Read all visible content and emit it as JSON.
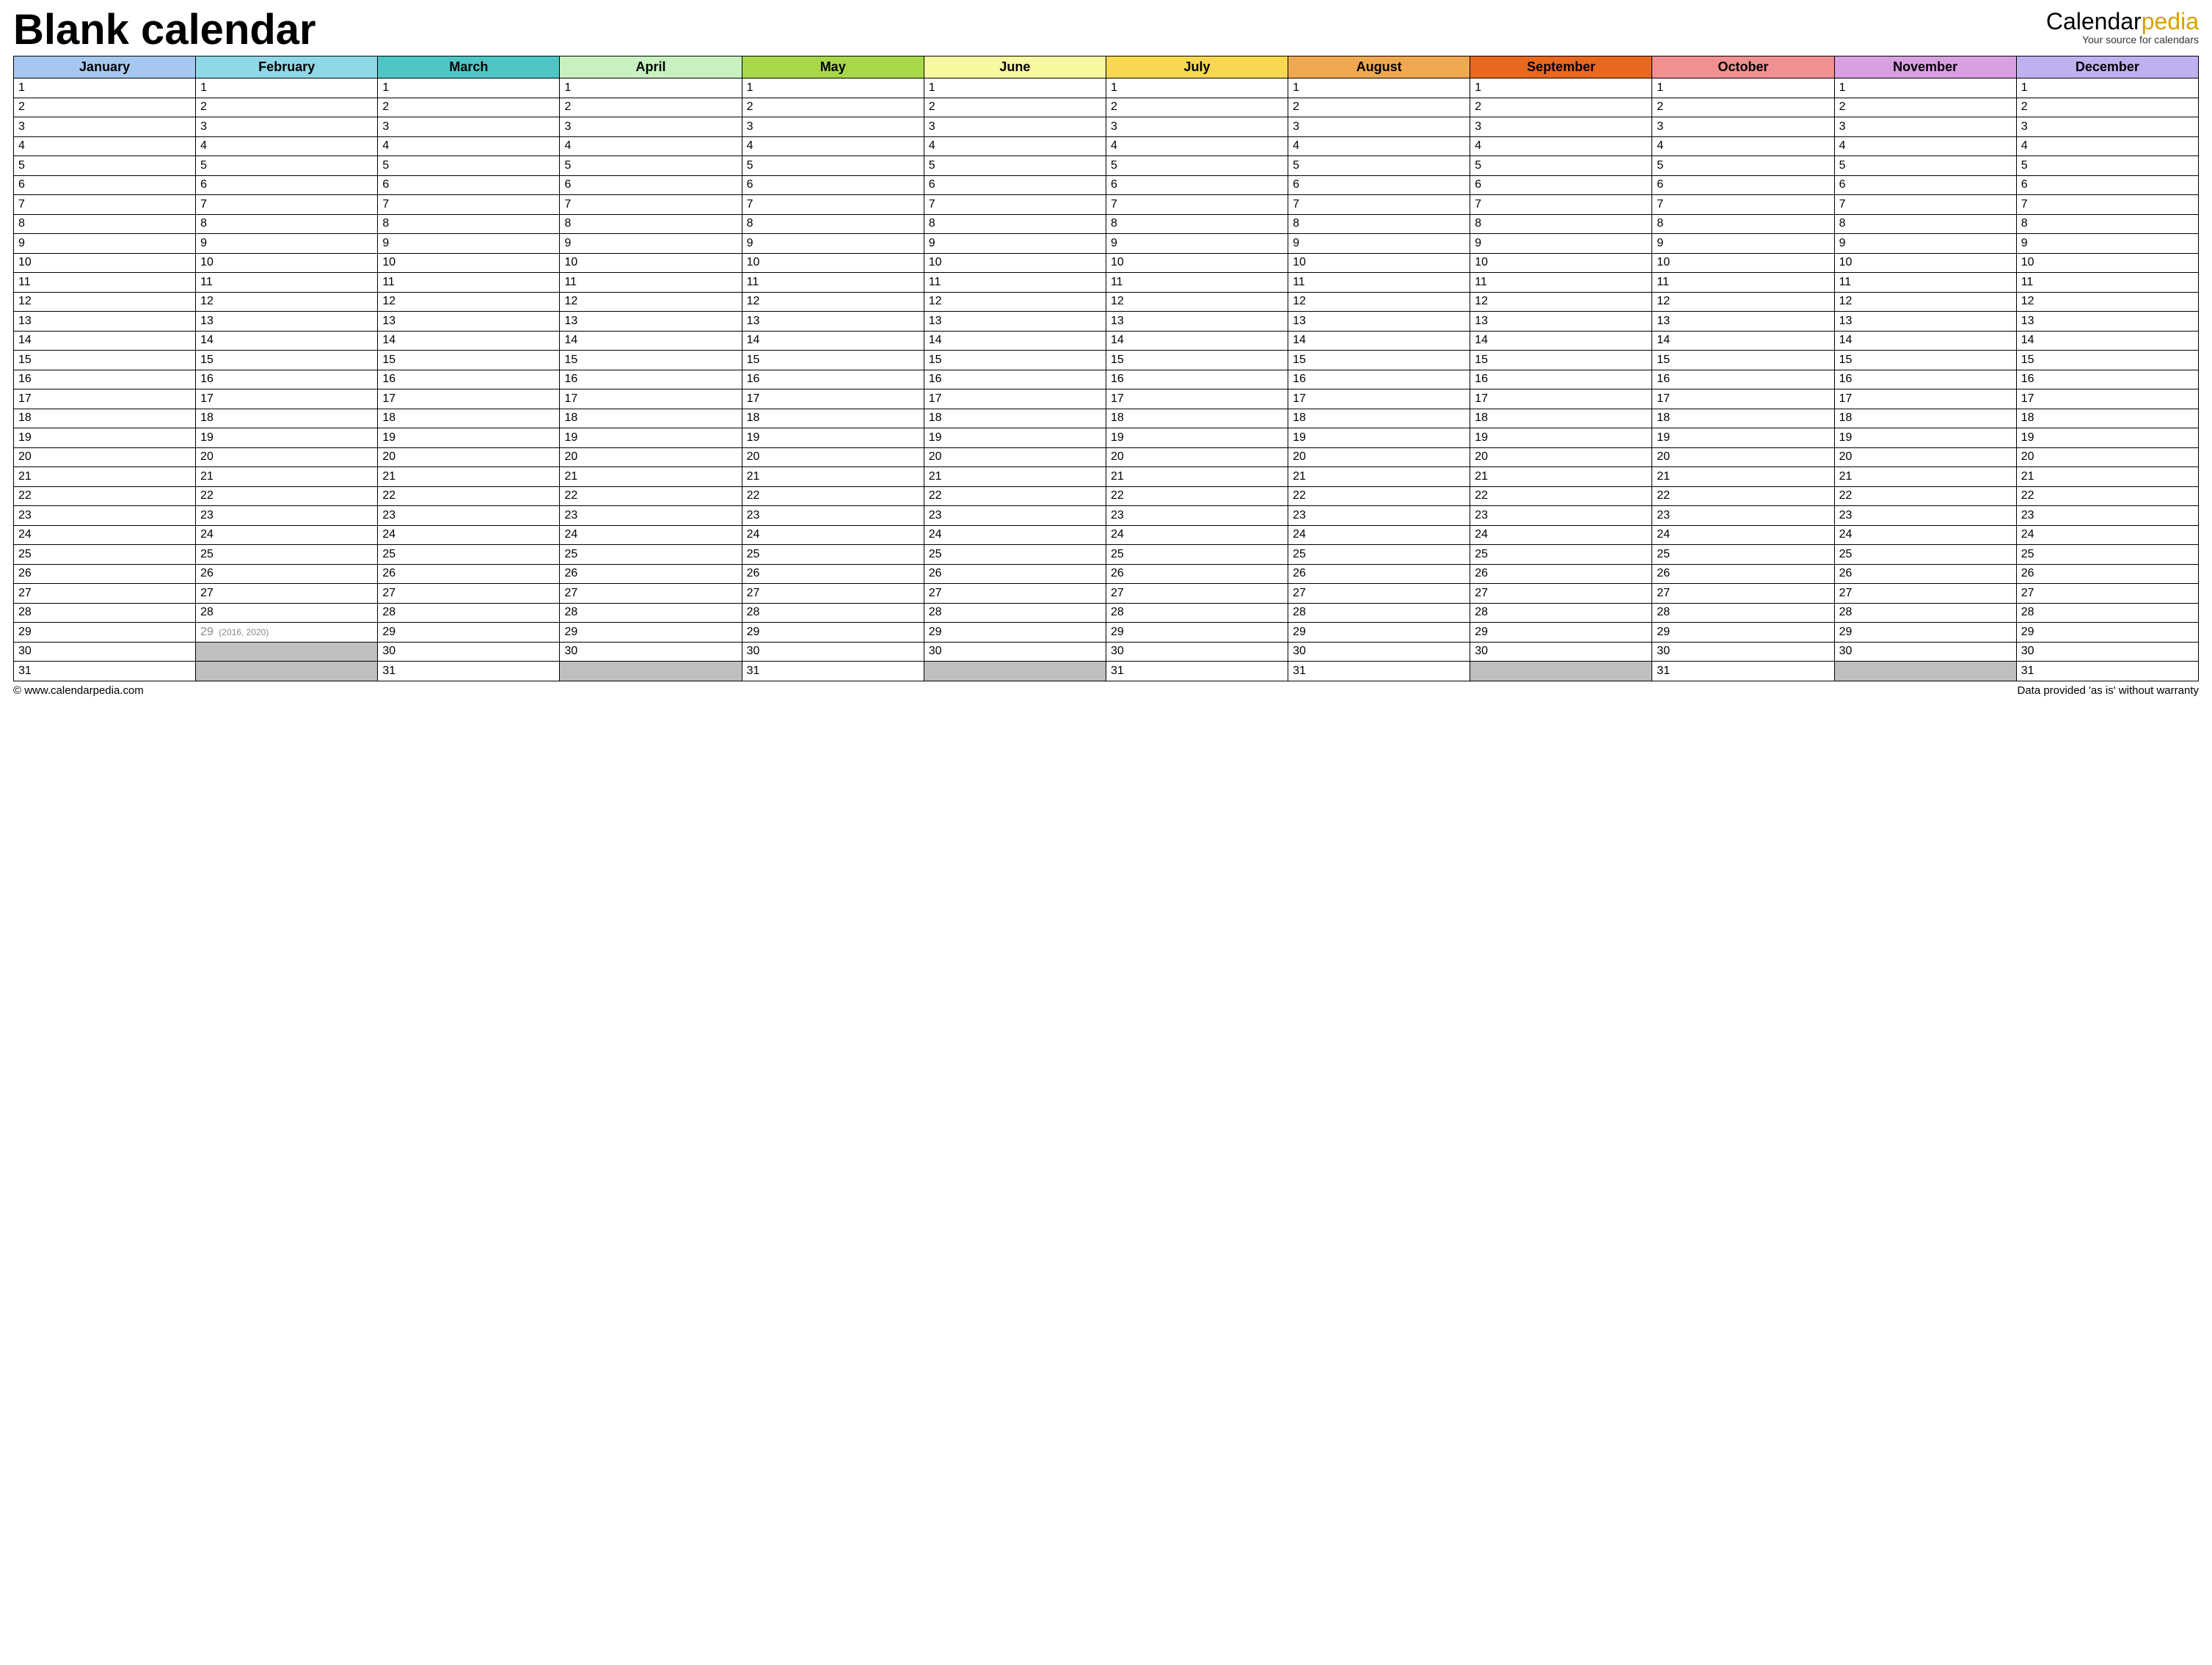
{
  "title": "Blank calendar",
  "brand": {
    "part1": "Calendar",
    "part2": "pedia",
    "tagline": "Your source for calendars"
  },
  "months": [
    {
      "name": "January",
      "days": 31,
      "leap_note": ""
    },
    {
      "name": "February",
      "days": 29,
      "leap_note": "(2016, 2020)"
    },
    {
      "name": "March",
      "days": 31,
      "leap_note": ""
    },
    {
      "name": "April",
      "days": 30,
      "leap_note": ""
    },
    {
      "name": "May",
      "days": 31,
      "leap_note": ""
    },
    {
      "name": "June",
      "days": 30,
      "leap_note": ""
    },
    {
      "name": "July",
      "days": 31,
      "leap_note": ""
    },
    {
      "name": "August",
      "days": 31,
      "leap_note": ""
    },
    {
      "name": "September",
      "days": 30,
      "leap_note": ""
    },
    {
      "name": "October",
      "days": 31,
      "leap_note": ""
    },
    {
      "name": "November",
      "days": 30,
      "leap_note": ""
    },
    {
      "name": "December",
      "days": 31,
      "leap_note": ""
    }
  ],
  "max_rows": 31,
  "footer": {
    "left": "© www.calendarpedia.com",
    "right": "Data provided 'as is' without warranty"
  }
}
